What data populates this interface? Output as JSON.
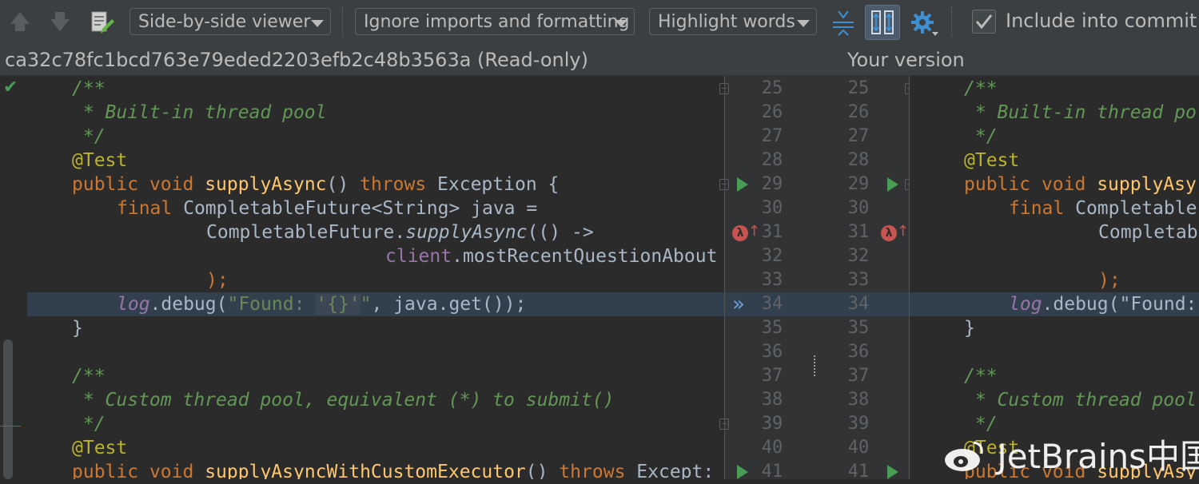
{
  "toolbar": {
    "viewer_mode": "Side-by-side viewer",
    "ignore_mode": "Ignore imports and formatting",
    "highlight_mode": "Highlight words",
    "include_commit_label": "Include into commit"
  },
  "left_pane": {
    "title": "ca32c78fc1bcd763e79eded2203efb2c48b3563a (Read-only)"
  },
  "right_pane": {
    "title": "Your version"
  },
  "line_numbers": [
    "25",
    "26",
    "27",
    "28",
    "29",
    "30",
    "31",
    "32",
    "33",
    "34",
    "35",
    "36",
    "37",
    "38",
    "39",
    "40",
    "41"
  ],
  "code": {
    "c1": "/**",
    "c2": " * Built-in thread pool",
    "c3": " */",
    "ann": "@Test",
    "kw_public": "public",
    "kw_void": "void",
    "m1": "supplyAsync",
    "m1_tail": "()",
    "kw_throws": "throws",
    "exc": "Exception {",
    "kw_final": "final",
    "decl": "CompletableFuture<String> java =",
    "cf_call": "CompletableFuture.",
    "sa_ital": "supplyAsync",
    "lambda_tail": "(() ->",
    "client": "client",
    "most_recent": ".mostRecentQuestionAbout",
    "close_paren": ");",
    "log": "log",
    "debug": ".debug(",
    "str1": "\"Found: ",
    "str2": "'{}'",
    "str3": "\"",
    "debug_tail": ", java.get());",
    "brace": "}",
    "c4": "/**",
    "c5": " * Custom thread pool, equivalent (*) to submit()",
    "c6": " */",
    "ann2": "@Test",
    "m2": "supplyAsyncWithCustomExecutor",
    "m2_tail": "() ",
    "exc2": "Except:"
  },
  "right_code": {
    "c2": " * Built-in thread po",
    "m1": "supplyAsy",
    "decl": "Completable",
    "cf": "Completab",
    "debug": ".debug(\"Found:",
    "c5": " * Custom thread pool",
    "m2": "supplyAsy"
  },
  "watermark": "JetBrains中国",
  "colors": {
    "keyword": "#cc7832",
    "comment": "#629755",
    "annotation": "#bbb529",
    "method": "#ffc66d",
    "string": "#6a8759",
    "field": "#9876aa",
    "highlight_row": "#32404d"
  },
  "icons": [
    "up-arrow-icon",
    "down-arrow-icon",
    "edit-source-icon",
    "collapse-unchanged-icon",
    "sync-scroll-icon",
    "gear-icon",
    "checkbox-checked-icon",
    "run-gutter-icon",
    "lambda-gutter-icon",
    "apply-change-icon",
    "fold-icon"
  ]
}
